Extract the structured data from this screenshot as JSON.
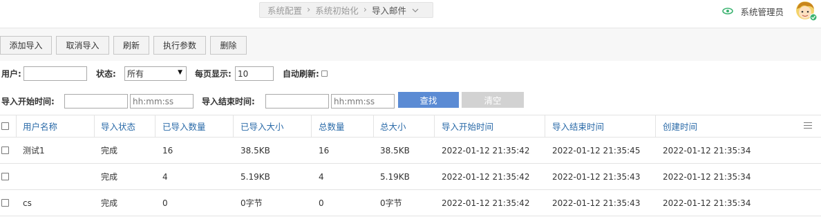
{
  "breadcrumb": {
    "items": [
      "系统配置",
      "系统初始化"
    ],
    "current": "导入邮件",
    "separator": "›"
  },
  "user": {
    "name": "系统管理员"
  },
  "toolbar": {
    "add": "添加导入",
    "cancel": "取消导入",
    "refresh": "刷新",
    "params": "执行参数",
    "delete": "删除"
  },
  "filters": {
    "user_label": "用户:",
    "user_value": "",
    "status_label": "状态:",
    "status_value": "所有",
    "per_page_label": "每页显示:",
    "per_page_value": "10",
    "auto_refresh_label": "自动刷新:",
    "start_label": "导入开始时间:",
    "start_date": "",
    "start_time_placeholder": "hh:mm:ss",
    "end_label": "导入结束时间:",
    "end_date": "",
    "end_time_placeholder": "hh:mm:ss",
    "search_label": "查找",
    "clear_label": "清空"
  },
  "table": {
    "headers": [
      "用户名称",
      "导入状态",
      "已导入数量",
      "已导入大小",
      "总数量",
      "总大小",
      "导入开始时间",
      "导入结束时间",
      "创建时间"
    ],
    "rows": [
      [
        "测试1",
        "完成",
        "16",
        "38.5KB",
        "16",
        "38.5KB",
        "2022-01-12 21:35:42",
        "2022-01-12 21:35:45",
        "2022-01-12 21:35:34"
      ],
      [
        "",
        "完成",
        "4",
        "5.19KB",
        "4",
        "5.19KB",
        "2022-01-12 21:35:42",
        "2022-01-12 21:35:43",
        "2022-01-12 21:35:34"
      ],
      [
        "cs",
        "完成",
        "0",
        "0字节",
        "0",
        "0字节",
        "2022-01-12 21:35:42",
        "2022-01-12 21:35:43",
        "2022-01-12 21:35:34"
      ]
    ]
  },
  "colors": {
    "header_text": "#2a6aa8",
    "search_button": "#5b8bd4",
    "clear_button": "#d2d2d2",
    "eye_icon": "#3cb371"
  }
}
